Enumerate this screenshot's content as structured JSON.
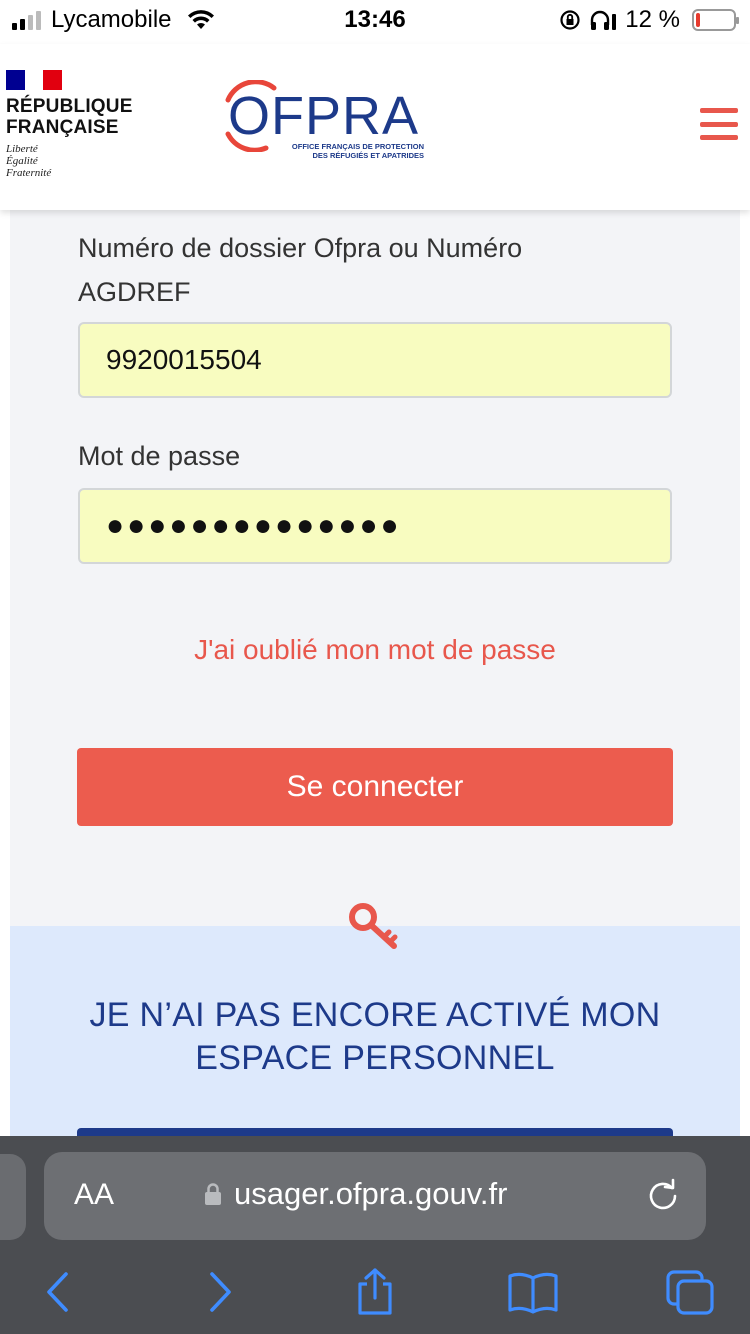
{
  "status_bar": {
    "carrier": "Lycamobile",
    "time": "13:46",
    "battery": "12 %",
    "battery_level": 0.12,
    "signal_bars": 2
  },
  "header": {
    "republic_line1": "RÉPUBLIQUE",
    "republic_line2": "FRANÇAISE",
    "motto_1": "Liberté",
    "motto_2": "Égalité",
    "motto_3": "Fraternité",
    "logo_text": "OFPRA",
    "logo_sub_1": "OFFICE FRANÇAIS DE PROTECTION",
    "logo_sub_2": "DES RÉFUGIÉS ET APATRIDES",
    "menu_icon": "hamburger-menu-icon"
  },
  "form": {
    "dossier_label": "Numéro de dossier Ofpra ou Numéro AGDREF",
    "dossier_value": "9920015504",
    "password_label": "Mot de passe",
    "password_value": "●●●●●●●●●●●●●●",
    "forgot_link": "J'ai oublié mon mot de passe",
    "submit_label": "Se connecter"
  },
  "activation": {
    "icon": "key-icon",
    "title": "JE N’AI PAS ENCORE ACTIVÉ MON ESPACE PERSONNEL"
  },
  "browser": {
    "aa_label": "AA",
    "url": "usager.ofpra.gouv.fr",
    "icons": [
      "back-icon",
      "forward-icon",
      "share-icon",
      "bookmarks-icon",
      "tabs-icon",
      "reload-icon",
      "lock-icon"
    ]
  },
  "colors": {
    "accent_red": "#ec5c4e",
    "brand_blue": "#1d3a8a",
    "input_bg": "#f8fcc0",
    "panel_blue": "#dde9fc",
    "browser_blue": "#3f8cff"
  }
}
